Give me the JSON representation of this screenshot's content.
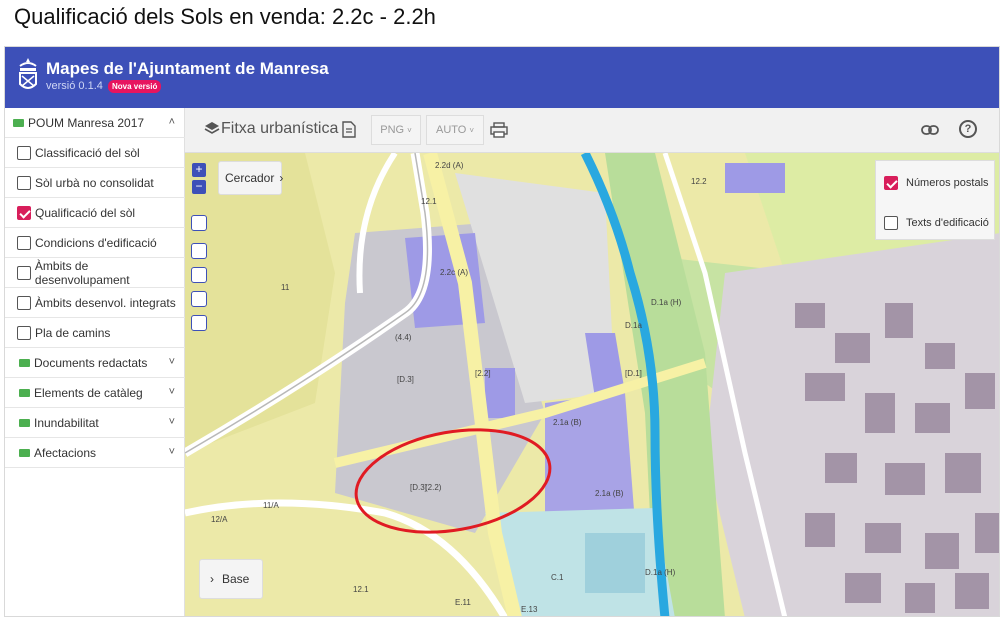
{
  "caption": "Qualificació dels Sols en venda:  2.2c  - 2.2h",
  "header": {
    "title": "Mapes de l'Ajuntament de Manresa",
    "version": "versió 0.1.4",
    "badge": "Nova versió"
  },
  "sidebar": {
    "group_title": "POUM Manresa 2017",
    "layers": [
      {
        "label": "Classificació del sòl",
        "checked": false
      },
      {
        "label": "Sòl urbà no consolidat",
        "checked": false
      },
      {
        "label": "Qualificació del sòl",
        "checked": true
      },
      {
        "label": "Condicions d'edificació",
        "checked": false
      },
      {
        "label": "Àmbits de desenvolupament",
        "checked": false
      },
      {
        "label": "Àmbits desenvol. integrats",
        "checked": false
      },
      {
        "label": "Pla de camins",
        "checked": false
      }
    ],
    "folders": [
      {
        "label": "Documents redactats"
      },
      {
        "label": "Elements de catàleg"
      },
      {
        "label": "Inundabilitat"
      },
      {
        "label": "Afectacions"
      }
    ]
  },
  "toolbar": {
    "title": "Fitxa urbanística",
    "format": "PNG",
    "scale": "AUTO"
  },
  "map": {
    "zoom_in": "+",
    "zoom_out": "−",
    "search": "Cercador",
    "base": "Base",
    "overlays": [
      {
        "label": "Números postals",
        "checked": true
      },
      {
        "label": "Texts d'edificació",
        "checked": false
      }
    ],
    "labels": [
      "2.2d (A)",
      "12.1",
      "2.2c (A)",
      "12.2",
      "11",
      "(4.4)",
      "[D.3]",
      "[2.2]",
      "[D.1]",
      "D.1a (H)",
      "D.1a",
      "2.1a (B)",
      "E.11",
      "C.1",
      "12.1",
      "E.13",
      "D.1a (H)",
      "11/A",
      "12/A",
      "2.1a (B)",
      "[D.3]",
      "(2.2)"
    ]
  },
  "colors": {
    "header": "#3d50b8",
    "badge": "#e7145f",
    "check": "#d81e5b",
    "folder": "#4caf50",
    "highlight_ellipse": "#e01b23",
    "river": "#29a8e0"
  }
}
